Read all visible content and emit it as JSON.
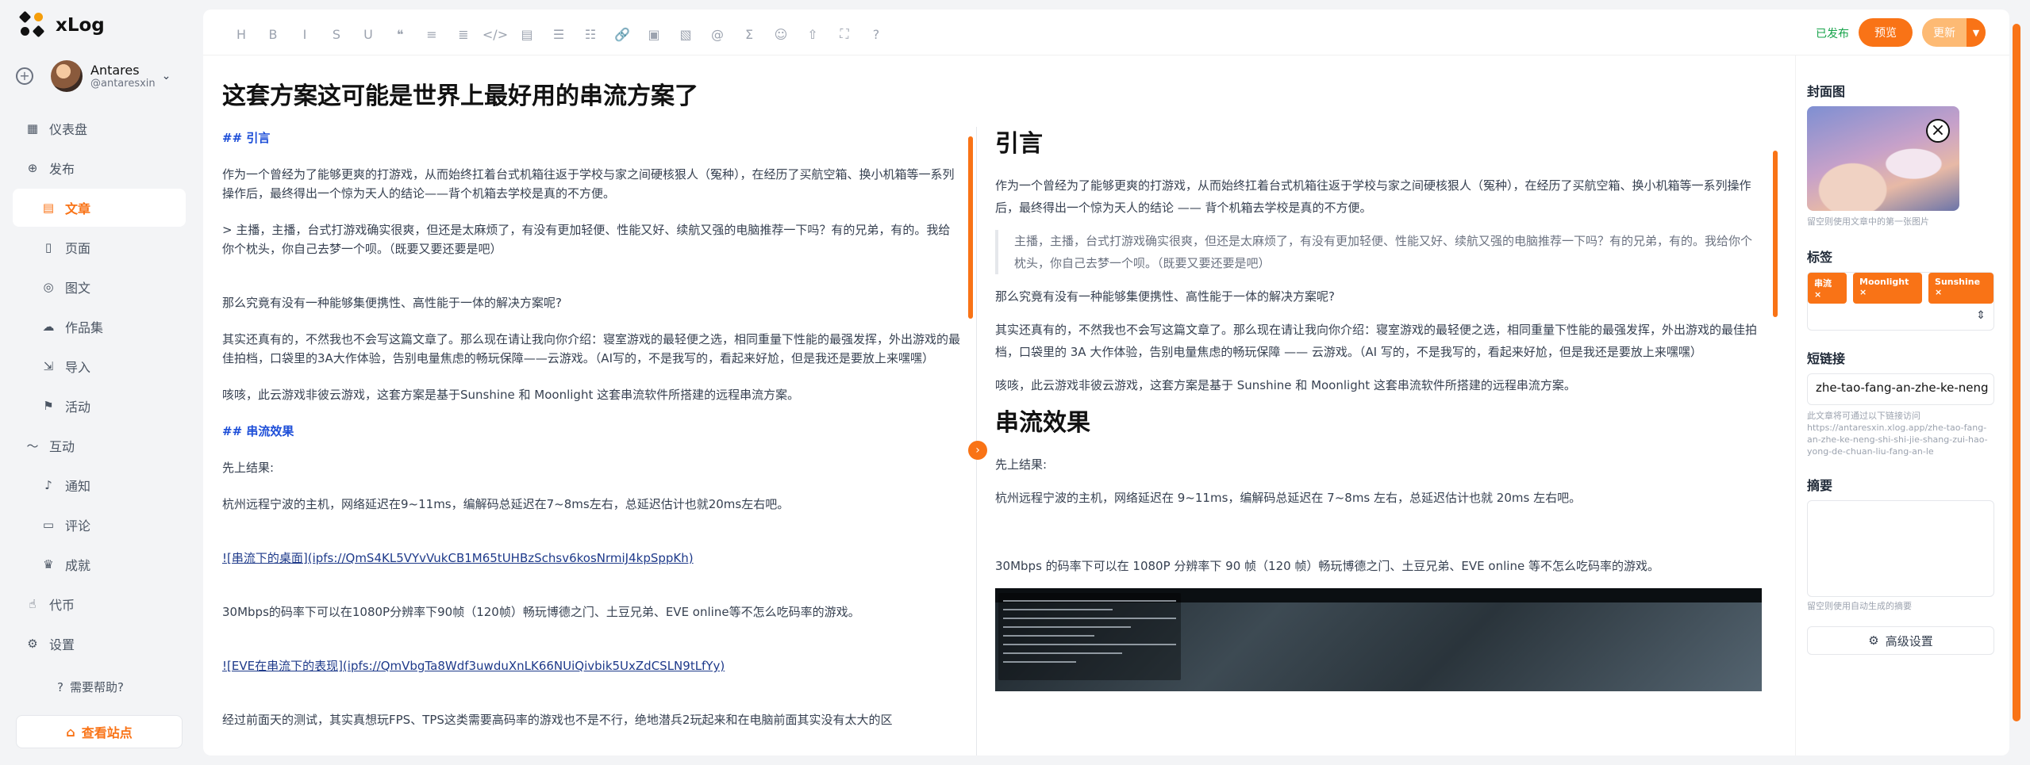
{
  "app": {
    "name": "xLog"
  },
  "account": {
    "name": "Antares",
    "handle": "@antaresxin"
  },
  "nav": {
    "dashboard": "仪表盘",
    "publish": "发布",
    "articles": "文章",
    "pages": "页面",
    "photos": "图文",
    "portfolio": "作品集",
    "import": "导入",
    "events": "活动",
    "interact": "互动",
    "notifications": "通知",
    "comments": "评论",
    "achievements": "成就",
    "token": "代币",
    "settings": "设置",
    "help": "需要帮助?",
    "view_site": "查看站点"
  },
  "toolbar": {
    "tools": [
      "H",
      "B",
      "I",
      "S",
      "U",
      "❝",
      "≡",
      "≣",
      "</>",
      "▤",
      "☰",
      "☷",
      "🔗",
      "▣",
      "▧",
      "@",
      "Σ",
      "☺",
      "⇧",
      "⛶",
      "?"
    ],
    "status": "已发布",
    "preview_label": "预览",
    "update_label": "更新"
  },
  "post": {
    "title": "这套方案这可能是世界上最好用的串流方案了"
  },
  "markdown": {
    "h_intro": "## 引言",
    "p1": "作为一个曾经为了能够更爽的打游戏，从而始终扛着台式机箱往返于学校与家之间硬核狠人（冤种），在经历了买航空箱、换小机箱等一系列操作后，最终得出一个惊为天人的结论——背个机箱去学校是真的不方便。",
    "quote": "> 主播，主播，台式打游戏确实很爽，但还是太麻烦了，有没有更加轻便、性能又好、续航又强的电脑推荐一下吗？有的兄弟，有的。我给你个枕头，你自己去梦一个呗。（既要又要还要是吧）",
    "p2": "那么究竟有没有一种能够集便携性、高性能于一体的解决方案呢?",
    "p3": "其实还真有的，不然我也不会写这篇文章了。那么现在请让我向你介绍：寝室游戏的最轻便之选，相同重量下性能的最强发挥，外出游戏的最佳拍档，口袋里的3A大作体验，告别电量焦虑的畅玩保障——云游戏。（AI写的，不是我写的，看起来好尬，但是我还是要放上来嘿嘿）",
    "p4": "咳咳，此云游戏非彼云游戏，这套方案是基于Sunshine 和 Moonlight 这套串流软件所搭建的远程串流方案。",
    "h_effect": "## 串流效果",
    "p5": "先上结果:",
    "p6": "杭州远程宁波的主机，网络延迟在9~11ms，编解码总延迟在7~8ms左右，总延迟估计也就20ms左右吧。",
    "img1": "![串流下的桌面](ipfs://QmS4KL5VYvVukCB1M65tUHBzSchsv6kosNrmiJ4kpSppKh)",
    "p7": "30Mbps的码率下可以在1080P分辨率下90帧（120帧）畅玩博德之门、土豆兄弟、EVE online等不怎么吃码率的游戏。",
    "img2": "![EVE在串流下的表现](ipfs://QmVbgTa8Wdf3uwduXnLK66NUiQivbik5UxZdCSLN9tLfYy)",
    "p8": "经过前面天的测试，其实真想玩FPS、TPS这类需要高码率的游戏也不是不行，绝地潜兵2玩起来和在电脑前面其实没有太大的区"
  },
  "preview": {
    "h_intro": "引言",
    "p1": "作为一个曾经为了能够更爽的打游戏，从而始终扛着台式机箱往返于学校与家之间硬核狠人（冤种），在经历了买航空箱、换小机箱等一系列操作后，最终得出一个惊为天人的结论 —— 背个机箱去学校是真的不方便。",
    "quote": "主播，主播，台式打游戏确实很爽，但还是太麻烦了，有没有更加轻便、性能又好、续航又强的电脑推荐一下吗？有的兄弟，有的。我给你个枕头，你自己去梦一个呗。（既要又要还要是吧）",
    "p2": "那么究竟有没有一种能够集便携性、高性能于一体的解决方案呢?",
    "p3": "其实还真有的，不然我也不会写这篇文章了。那么现在请让我向你介绍：寝室游戏的最轻便之选，相同重量下性能的最强发挥，外出游戏的最佳拍档，口袋里的 3A 大作体验，告别电量焦虑的畅玩保障 —— 云游戏。（AI 写的，不是我写的，看起来好尬，但是我还是要放上来嘿嘿）",
    "p4": "咳咳，此云游戏非彼云游戏，这套方案是基于 Sunshine 和 Moonlight 这套串流软件所搭建的远程串流方案。",
    "h_effect": "串流效果",
    "p5": "先上结果:",
    "p6": "杭州远程宁波的主机，网络延迟在 9~11ms，编解码总延迟在 7~8ms 左右，总延迟估计也就 20ms 左右吧。",
    "p7": "30Mbps 的码率下可以在 1080P 分辨率下 90 帧（120 帧）畅玩博德之门、土豆兄弟、EVE online 等不怎么吃码率的游戏。"
  },
  "settings_panel": {
    "cover_label": "封面图",
    "cover_hint": "留空则使用文章中的第一张图片",
    "tags_label": "标签",
    "tags": [
      "串流",
      "Moonlight",
      "Sunshine"
    ],
    "slug_label": "短链接",
    "slug_value": "zhe-tao-fang-an-zhe-ke-neng",
    "slug_hint": "此文章将可通过以下链接访问 https://antaresxin.xlog.app/zhe-tao-fang-an-zhe-ke-neng-shi-shi-jie-shang-zui-hao-yong-de-chuan-liu-fang-an-le",
    "summary_label": "摘要",
    "summary_hint": "留空则使用自动生成的摘要",
    "advanced_label": "高级设置"
  },
  "colors": {
    "accent": "#f97316",
    "published": "#16a34a",
    "md_heading": "#1d4ed8"
  }
}
